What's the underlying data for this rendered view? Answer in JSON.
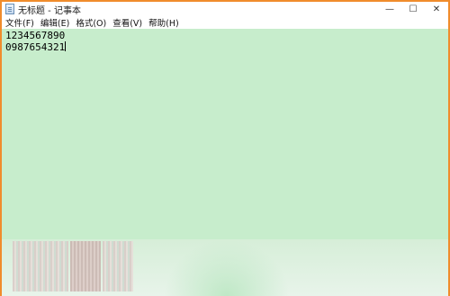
{
  "window": {
    "title": "无标题 - 记事本",
    "controls": {
      "minimize": "—",
      "maximize": "☐",
      "close": "✕"
    }
  },
  "menubar": {
    "items": [
      {
        "label": "文件(F)"
      },
      {
        "label": "编辑(E)"
      },
      {
        "label": "格式(O)"
      },
      {
        "label": "查看(V)"
      },
      {
        "label": "帮助(H)"
      }
    ]
  },
  "editor": {
    "lines": [
      "1234567890",
      "0987654321"
    ],
    "background_color": "#c7edcc"
  },
  "colors": {
    "window_border": "#f08c2c"
  }
}
